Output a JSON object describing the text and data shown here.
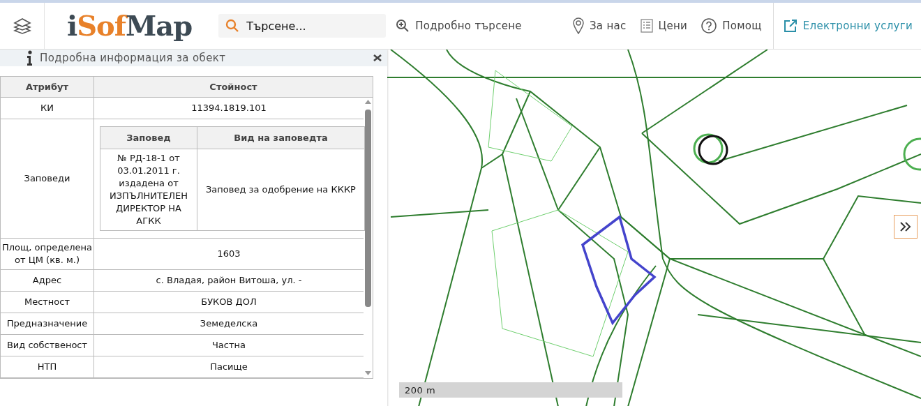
{
  "header": {
    "logo": [
      "i",
      "Sof",
      "Map"
    ],
    "search": {
      "placeholder": "Търсене..."
    },
    "nav": [
      {
        "kind": "search",
        "label": "Подробно търсене"
      },
      {
        "kind": "pin",
        "label": "За нас"
      },
      {
        "kind": "list",
        "label": "Цени"
      },
      {
        "kind": "help",
        "label": "Помощ"
      },
      {
        "kind": "external",
        "label": "Електронни услуги"
      }
    ]
  },
  "info_panel": {
    "title": "Подробна информация за обект",
    "table": {
      "columns": [
        "Атрибут",
        "Стойност"
      ],
      "rows": [
        {
          "attribute": "КИ",
          "value": "11394.1819.101"
        },
        {
          "attribute": "Заповеди",
          "orders": {
            "columns": [
              "Заповед",
              "Вид на заповедта"
            ],
            "rows": [
              [
                "№ РД-18-1 от 03.01.2011 г. издадена от ИЗПЪЛНИТЕЛЕН ДИРЕКТОР НА АГКК",
                "Заповед за одобрение на КККР"
              ]
            ]
          }
        },
        {
          "attribute": "Площ, определена от ЦМ (кв. м.)",
          "value": "1603"
        },
        {
          "attribute": "Адрес",
          "value": "с. Владая, район Витоша, ул. -"
        },
        {
          "attribute": "Местност",
          "value": "БУКОВ ДОЛ"
        },
        {
          "attribute": "Предназначение",
          "value": "Земеделска"
        },
        {
          "attribute": "Вид собственост",
          "value": "Частна"
        },
        {
          "attribute": "НТП",
          "value": "Пасище"
        }
      ]
    }
  },
  "map": {
    "scale": "200 m"
  }
}
